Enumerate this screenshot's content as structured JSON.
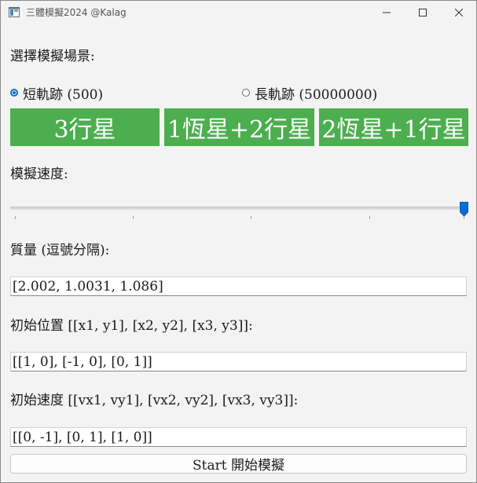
{
  "window": {
    "title": "三體模擬2024 @Kalag"
  },
  "scenario": {
    "label": "選擇模擬場景:",
    "radios": [
      {
        "label": "短軌跡 (500)",
        "checked": true
      },
      {
        "label": "長軌跡 (50000000)",
        "checked": false
      }
    ],
    "buttons": [
      "3行星",
      "1恆星+2行星",
      "2恆星+1行星"
    ],
    "button_color": "#4cae4f"
  },
  "speed": {
    "label": "模擬速度:",
    "value_fraction": 1.0
  },
  "mass": {
    "label": "質量 (逗號分隔):",
    "value": "[2.002, 1.0031, 1.086]"
  },
  "position": {
    "label": "初始位置 [[x1, y1], [x2, y2], [x3, y3]]:",
    "value": "[[1, 0], [-1, 0], [0, 1]]"
  },
  "velocity": {
    "label": "初始速度 [[vx1, vy1], [vx2, vy2], [vx3, vy3]]:",
    "value": "[[0, -1], [0, 1], [1, 0]]"
  },
  "start_button": {
    "label": "Start 開始模擬"
  },
  "accent_color": "#0b6bd3"
}
